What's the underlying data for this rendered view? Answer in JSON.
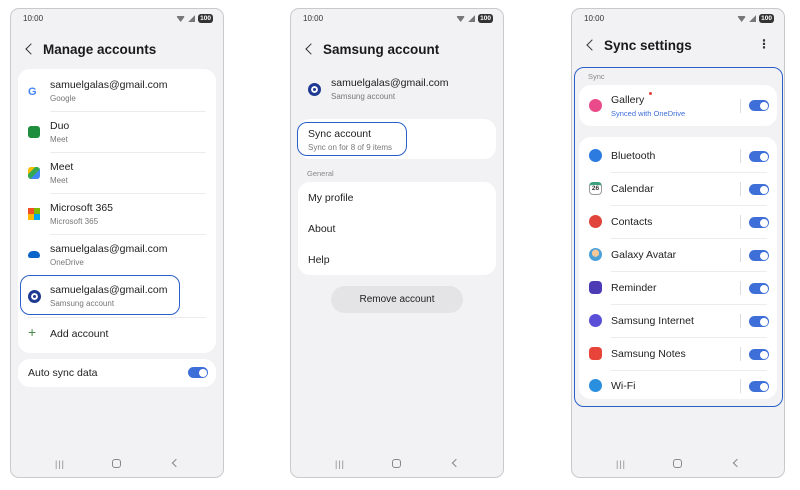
{
  "status": {
    "time": "10:00",
    "battery": "100"
  },
  "manage_accounts": {
    "title": "Manage accounts",
    "accounts": [
      {
        "name": "samuelgalas@gmail.com",
        "type": "Google",
        "icon": "google-icon"
      },
      {
        "name": "Duo",
        "type": "Meet",
        "icon": "duo-icon"
      },
      {
        "name": "Meet",
        "type": "Meet",
        "icon": "meet-icon"
      },
      {
        "name": "Microsoft 365",
        "type": "Microsoft 365",
        "icon": "microsoft-icon"
      },
      {
        "name": "samuelgalas@gmail.com",
        "type": "OneDrive",
        "icon": "onedrive-icon"
      },
      {
        "name": "samuelgalas@gmail.com",
        "type": "Samsung account",
        "icon": "samsung-account-icon"
      }
    ],
    "add_account": "Add account",
    "auto_sync": "Auto sync data"
  },
  "samsung_account": {
    "title": "Samsung account",
    "email": "samuelgalas@gmail.com",
    "email_sub": "Samsung account",
    "sync_title": "Sync account",
    "sync_sub": "Sync on for 8 of 9 items",
    "general_label": "General",
    "menu": [
      "My profile",
      "About",
      "Help"
    ],
    "remove": "Remove account"
  },
  "sync_settings": {
    "title": "Sync settings",
    "more": "⋮",
    "section": "Sync",
    "gallery": {
      "label": "Gallery",
      "sub": "Synced with OneDrive"
    },
    "calendar_day": "26",
    "items": [
      "Bluetooth",
      "Calendar",
      "Contacts",
      "Galaxy Avatar",
      "Reminder",
      "Samsung Internet",
      "Samsung Notes",
      "Wi-Fi"
    ]
  },
  "colors": {
    "accent": "#3e6fd8",
    "highlight": "#2b5fc8",
    "bg": "#f2f2f4"
  }
}
